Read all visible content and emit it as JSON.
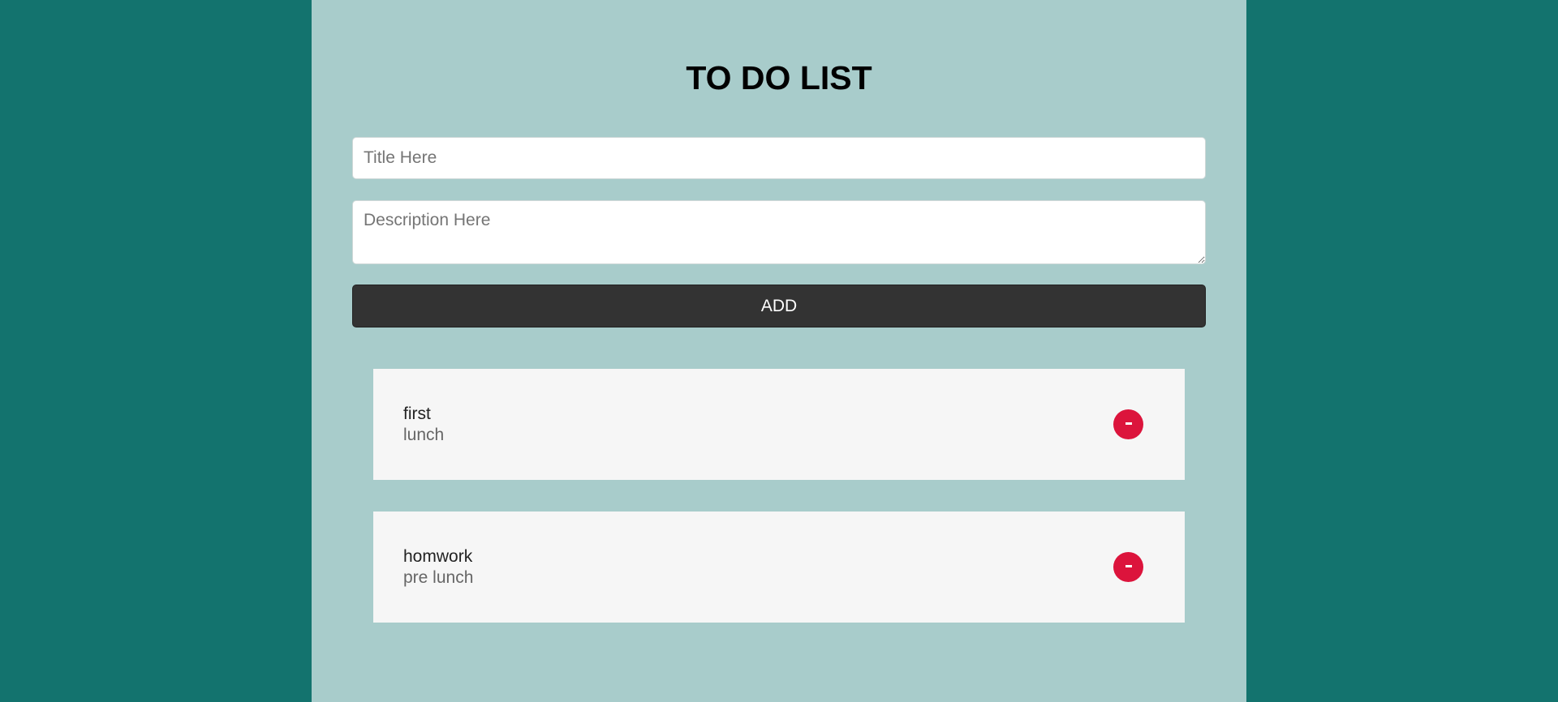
{
  "header": {
    "title": "TO DO LIST"
  },
  "form": {
    "title_placeholder": "Title Here",
    "title_value": "",
    "description_placeholder": "Description Here",
    "description_value": "",
    "add_label": "ADD"
  },
  "todos": [
    {
      "title": "first",
      "description": "lunch",
      "remove_icon": "minus-icon"
    },
    {
      "title": "homwork",
      "description": "pre lunch",
      "remove_icon": "minus-icon"
    }
  ],
  "colors": {
    "page_background": "#13736e",
    "panel_background": "#a8cccb",
    "button_background": "#333333",
    "item_background": "#f6f6f6",
    "remove_button": "#dc143c"
  }
}
